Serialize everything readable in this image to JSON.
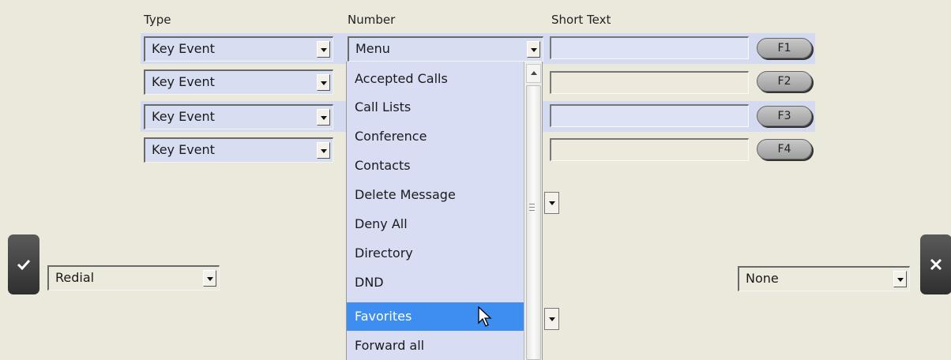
{
  "headers": {
    "type": "Type",
    "number": "Number",
    "short_text": "Short Text"
  },
  "rows": [
    {
      "type": "Key Event",
      "fkey": "F1"
    },
    {
      "type": "Key Event",
      "fkey": "F2"
    },
    {
      "type": "Key Event",
      "fkey": "F3"
    },
    {
      "type": "Key Event",
      "fkey": "F4"
    }
  ],
  "number_select": {
    "value": "Menu"
  },
  "dropdown": {
    "options": [
      "Accepted Calls",
      "Call Lists",
      "Conference",
      "Contacts",
      "Delete Message",
      "Deny All",
      "Directory",
      "DND",
      "Favorites",
      "Forward all"
    ],
    "selected": "Favorites"
  },
  "left_select": {
    "value": "Redial"
  },
  "right_select": {
    "value": "None"
  },
  "icons": {
    "confirm": "check-icon",
    "cancel": "close-icon"
  },
  "colors": {
    "highlight": "#3d8ef0",
    "background": "#ebe8dc",
    "field_blue": "#d8def2"
  }
}
